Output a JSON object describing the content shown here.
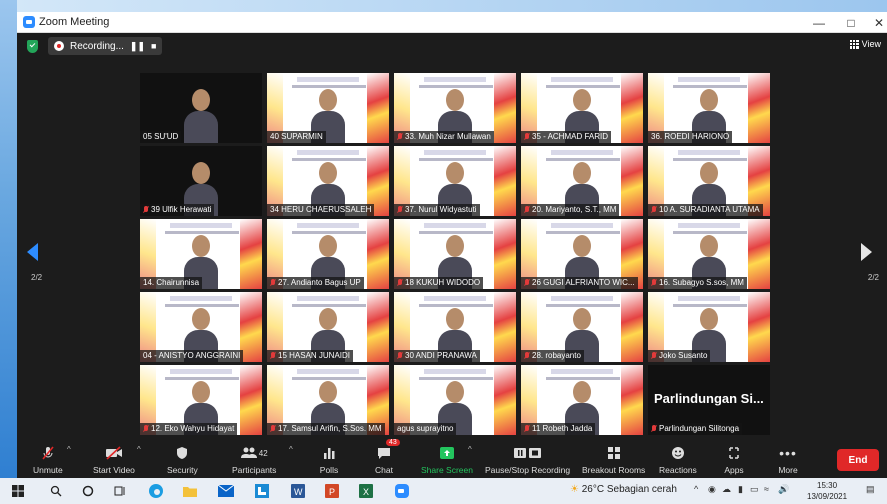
{
  "window": {
    "title": "Zoom Meeting"
  },
  "topbar": {
    "recording_label": "Recording...",
    "view_label": "View"
  },
  "pages": {
    "left": "2/2",
    "right": "2/2"
  },
  "tiles": [
    {
      "name": "05 SU'UD",
      "muted": false
    },
    {
      "name": "40 SUPARMIN",
      "muted": false
    },
    {
      "name": "33. Muh Nizar Mullawan",
      "muted": true
    },
    {
      "name": "35 - ACHMAD FARID",
      "muted": true
    },
    {
      "name": "36. ROEDI HARIONO",
      "muted": false
    },
    {
      "name": "39 Ulfik Herawati",
      "muted": true
    },
    {
      "name": "34 HERU CHAERUSSALEH",
      "muted": false
    },
    {
      "name": "37. Nurul Widyastuti",
      "muted": true
    },
    {
      "name": "20. Mariyanto, S.T., MM",
      "muted": true
    },
    {
      "name": "10 A. SURADIANTA UTAMA",
      "muted": true
    },
    {
      "name": "14. Chairunnisa",
      "muted": false
    },
    {
      "name": "27. Andianto Bagus UP",
      "muted": true
    },
    {
      "name": "18 KUKUH WIDODO",
      "muted": true
    },
    {
      "name": "26 GUGI ALFRIANTO WIC...",
      "muted": true
    },
    {
      "name": "16. Subagyo S.sos, MM",
      "muted": true
    },
    {
      "name": "04 - ANISTYO ANGGRAINI",
      "muted": false
    },
    {
      "name": "15 HASAN JUNAIDI",
      "muted": true
    },
    {
      "name": "30 ANDI PRANAWA",
      "muted": true
    },
    {
      "name": "28. robayanto",
      "muted": true
    },
    {
      "name": "Joko Susanto",
      "muted": true
    },
    {
      "name": "12. Eko Wahyu Hidayat",
      "muted": true
    },
    {
      "name": "17. Samsul Arifin, S.Sos. MM",
      "muted": true
    },
    {
      "name": "agus suprayitno",
      "muted": false
    },
    {
      "name": "11 Robeth Jadda",
      "muted": true
    },
    {
      "name": "Parlindungan Silitonga",
      "muted": true,
      "display_name": "Parlindungan Si..."
    }
  ],
  "toolbar": {
    "unmute": "Unmute",
    "start_video": "Start Video",
    "security": "Security",
    "participants": "Participants",
    "participants_count": "42",
    "polls": "Polls",
    "chat": "Chat",
    "chat_badge": "43",
    "share_screen": "Share Screen",
    "pause_recording": "Pause/Stop Recording",
    "breakout_rooms": "Breakout Rooms",
    "reactions": "Reactions",
    "apps": "Apps",
    "more": "More",
    "end": "End"
  },
  "taskbar": {
    "weather": "26°C  Sebagian cerah",
    "time": "15:30",
    "date": "13/09/2021"
  },
  "colors": {
    "accent": "#2d8cff",
    "end": "#e02828",
    "share": "#23c55e",
    "active_speaker": "#e8e81a"
  }
}
